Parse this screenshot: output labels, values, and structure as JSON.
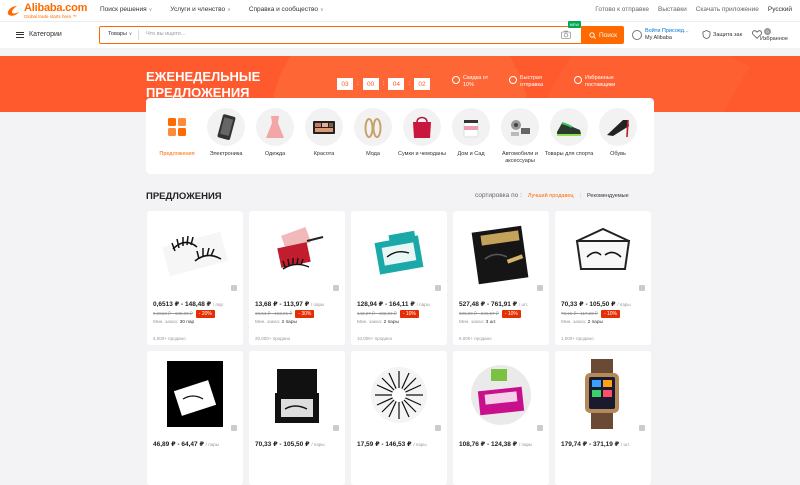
{
  "topbar": {
    "logo_text": "Alibaba.com",
    "logo_sub": "Global trade starts here.™",
    "nav": [
      {
        "label": "Поиск решения"
      },
      {
        "label": "Услуги и членство"
      },
      {
        "label": "Справка и сообщество"
      }
    ],
    "links": [
      {
        "label": "Готово к отправке"
      },
      {
        "label": "Выставки"
      },
      {
        "label": "Скачать приложение"
      },
      {
        "label": "Русский"
      }
    ]
  },
  "search": {
    "categories_label": "Категории",
    "type_select": "Товары",
    "placeholder": "Что вы ищете...",
    "new_tag": "NEW",
    "button_label": "Поиск"
  },
  "account": {
    "signin": "Войти   Присоед...",
    "my": "My Alibaba",
    "protection": "Защита зак",
    "favorites": "Избранное",
    "fav_count": "0"
  },
  "banner": {
    "title": "ЕЖЕНЕДЕЛЬНЫЕ ПРЕДЛОЖЕНИЯ",
    "timer": [
      "03",
      "00",
      "04",
      "02"
    ],
    "features": [
      {
        "line1": "Скидка от",
        "line2": "10%"
      },
      {
        "line1": "Быстрая",
        "line2": "отправка"
      },
      {
        "line1": "Избранные",
        "line2": "поставщики"
      }
    ]
  },
  "categories": [
    {
      "label": "Предложения",
      "active": true,
      "icon": "deals-grid-icon"
    },
    {
      "label": "Электроника",
      "active": false,
      "icon": "phone-icon"
    },
    {
      "label": "Одежда",
      "active": false,
      "icon": "dress-icon"
    },
    {
      "label": "Красота",
      "active": false,
      "icon": "palette-icon"
    },
    {
      "label": "Мода",
      "active": false,
      "icon": "earrings-icon"
    },
    {
      "label": "Сумки и чемоданы",
      "active": false,
      "icon": "handbag-icon"
    },
    {
      "label": "Дом и Сад",
      "active": false,
      "icon": "candle-icon"
    },
    {
      "label": "Автомобили и аксессуары",
      "active": false,
      "icon": "car-parts-icon"
    },
    {
      "label": "Товары для спорта",
      "active": false,
      "icon": "sneaker-icon"
    },
    {
      "label": "Обувь",
      "active": false,
      "icon": "high-heel-icon"
    }
  ],
  "section": {
    "title": "ПРЕДЛОЖЕНИЯ",
    "sort_label": "сортировка по :",
    "sort_active": "Лучший продавец",
    "sort_other": "Рекомендуемые"
  },
  "products": [
    {
      "price": "0,6513 ₽ - 148,48 ₽",
      "unit": "/ пар",
      "old": "0,6513 ₽ - 185,60 ₽",
      "discount": "- 20%",
      "moq_label": "Мин. заказ:",
      "moq": "30 пар",
      "sold": "4,000+ продано",
      "icon": "lashes-icon"
    },
    {
      "price": "13,68 ₽ - 113,97 ₽",
      "unit": "/ пары",
      "old": "19,54 ₽ - 162,81 ₽",
      "discount": "- 30%",
      "moq_label": "Мин. заказ:",
      "moq": "2 пары",
      "sold": "20,000+ продано",
      "icon": "lashes-box-icon"
    },
    {
      "price": "128,94 ₽ - 164,11 ₽",
      "unit": "/ пары",
      "old": "143,27 ₽ - 182,34 ₽",
      "discount": "- 10%",
      "moq_label": "Мин. заказ:",
      "moq": "2 пары",
      "sold": "10,000+ продано",
      "icon": "lashes-teal-box-icon"
    },
    {
      "price": "527,48 ₽ - 761,91 ₽",
      "unit": "/ шт.",
      "old": "586,09 ₽ - 846,57 ₽",
      "discount": "- 10%",
      "moq_label": "Мин. заказ:",
      "moq": "3 шт.",
      "sold": "6,000+ продано",
      "icon": "magnetic-lashes-kit-icon"
    },
    {
      "price": "70,33 ₽ - 105,50 ₽",
      "unit": "/ пары",
      "old": "78,15 ₽ - 117,22 ₽",
      "discount": "- 10%",
      "moq_label": "Мин. заказ:",
      "moq": "2 пары",
      "sold": "1,000+ продано",
      "icon": "lashes-clear-case-icon"
    },
    {
      "price": "46,89 ₽ - 64,47 ₽",
      "unit": "/ пары",
      "icon": "lashes-white-box-icon"
    },
    {
      "price": "70,33 ₽ - 105,50 ₽",
      "unit": "/ пары",
      "icon": "lashes-black-case-icon"
    },
    {
      "price": "17,59 ₽ - 146,53 ₽",
      "unit": "/ пары",
      "icon": "lashes-fluffy-icon"
    },
    {
      "price": "108,76 ₽ - 124,38 ₽",
      "unit": "/ пары",
      "icon": "lashes-pink-box-icon"
    },
    {
      "price": "179,74 ₽ - 371,19 ₽",
      "unit": "/ шт.",
      "icon": "smartwatch-icon"
    }
  ],
  "colors": {
    "accent": "#ff6a00",
    "banner": "#ff5a2e",
    "discount": "#e62e04"
  }
}
